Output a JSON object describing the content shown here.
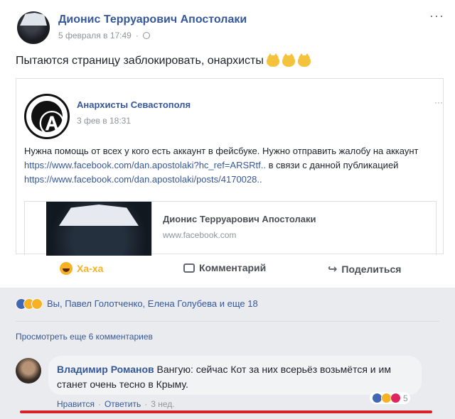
{
  "post": {
    "author": "Дионис Терруарович Апостолаки",
    "date": "5 февраля в 17:49",
    "separator": "·",
    "more": "···",
    "text": "Пытаются страницу заблокировать, онархисты"
  },
  "shared": {
    "group_name": "Анархисты Севастополя",
    "time": "3 фев в 18:31",
    "more": "···",
    "text_1": "Нужна помощь от всех у кого есть аккаунт в фейсбуке. Нужно отправить жалобу на аккаунт ",
    "link_1": "https://www.facebook.com/dan.apostolaki?hc_ref=ARSRtf..",
    "text_2": " в связи с данной публикацией ",
    "link_2": "https://www.facebook.com/dan.apostolaki/posts/4170028..",
    "card_title": "Дионис Терруарович Апостолаки",
    "card_domain": "www.facebook.com"
  },
  "actions": {
    "haha": "Ха-ха",
    "comment": "Комментарий",
    "share": "Поделиться"
  },
  "reactions": {
    "summary": "Вы, Павел Голотченко, Елена Голубева и еще 18"
  },
  "comments": {
    "view_more": "Просмотреть еще 6 комментариев",
    "items": [
      {
        "name": "Владимир Романов",
        "text": "Вангую: сейчас Кот за них всерьёз возьмётся и им станет очень тесно в Крыму.",
        "reaction_count": "5",
        "like": "Нравится",
        "reply": "Ответить",
        "sep": "·",
        "time": "3 нед."
      }
    ]
  },
  "colors": {
    "link": "#365899",
    "haha": "#f7b125",
    "highlight": "#d8202a"
  }
}
